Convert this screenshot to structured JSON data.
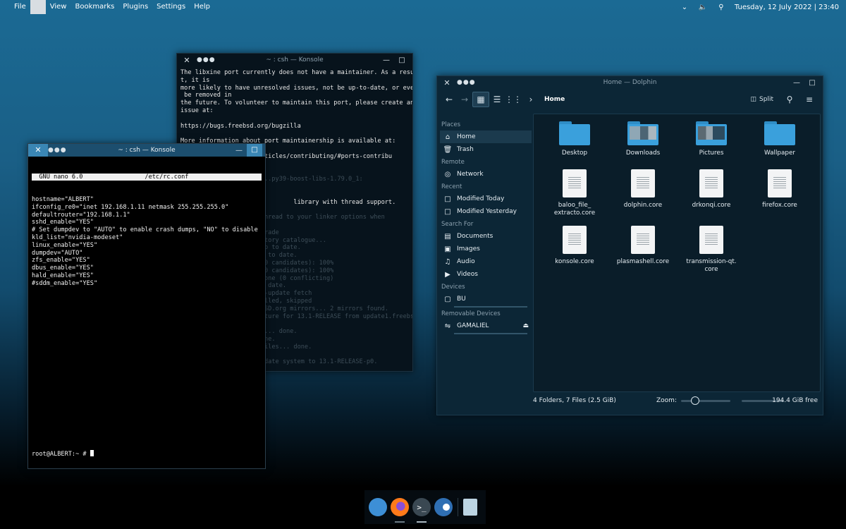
{
  "top_panel": {
    "menu": [
      "File",
      "",
      "View",
      "Bookmarks",
      "Plugins",
      "Settings",
      "Help"
    ],
    "tray_icons": [
      "chevron-down-icon",
      "volume-icon",
      "search-icon"
    ],
    "clock": "Tuesday, 12 July 2022 | 23:40"
  },
  "konsole_back": {
    "title": "~ : csh — Konsole",
    "lines_bright": [
      "The libxine port currently does not have a maintainer. As a resul",
      "t, it is",
      "more likely to have unresolved issues, not be up-to-date, or even",
      " be removed in",
      "the future. To volunteer to maintain this port, please create an",
      "issue at:",
      "",
      "https://bugs.freebsd.org/bugzilla",
      "",
      "More information about port maintainership is available at:"
    ],
    "line_url": "                 /en/articles/contributing/#ports-contribu",
    "line_pkg": "                      ...py39-boost-libs-1.79.0_1:",
    "line_thread": "                               library with thread support.",
    "lines_tail": [
      "Don't forget to add -pthread to your linker options when",
      "linking your code.",
      "root@ALBERT:~ # pkg upgrade",
      "Updating FreeBSD repository catalogue...",
      "FreeBSD repository is up to date.",
      "All repositories are up to date.",
      "Checking for upgrades (0 candidates): 100%",
      "Processing candidates (0 candidates): 100%",
      "Checking integrity... done (0 conflicting)",
      "Your packages are up to date.",
      "root@ALBERT:~ # freebsd-update fetch",
      "src component not installed, skipped",
      "Looking up update.FreeBSD.org mirrors... 2 mirrors found.",
      "Fetching metadata signature for 13.1-RELEASE from update1.freebsd",
      ".org... done.",
      "Fetching metadata index... done.",
      "Inspecting system... done.",
      "Preparing to download files... done.",
      "",
      "No updates needed to update system to 13.1-RELEASE-p0.",
      "root@ALBERT:~ # "
    ]
  },
  "konsole_front": {
    "title": "~ : csh — Konsole",
    "nano_header": "  GNU nano 6.0                 /etc/rc.conf                      ",
    "lines": [
      "hostname=\"ALBERT\"",
      "ifconfig_re0=\"inet 192.168.1.11 netmask 255.255.255.0\"",
      "defaultrouter=\"192.168.1.1\"",
      "sshd_enable=\"YES\"",
      "# Set dumpdev to \"AUTO\" to enable crash dumps, \"NO\" to disable",
      "kld_list=\"nvidia-modeset\"",
      "linux_enable=\"YES\"",
      "dumpdev=\"AUTO\"",
      "zfs_enable=\"YES\"",
      "dbus_enable=\"YES\"",
      "hald_enable=\"YES\"",
      "#sddm_enable=\"YES\""
    ],
    "prompt": "root@ALBERT:~ # "
  },
  "dolphin": {
    "title": "Home — Dolphin",
    "breadcrumb": "Home",
    "split_label": "Split",
    "places": [
      {
        "header": "Places",
        "items": [
          {
            "label": "Home",
            "icon": "home-icon",
            "selected": true
          },
          {
            "label": "Trash",
            "icon": "trash-icon"
          }
        ]
      },
      {
        "header": "Remote",
        "items": [
          {
            "label": "Network",
            "icon": "network-icon"
          }
        ]
      },
      {
        "header": "Recent",
        "items": [
          {
            "label": "Modified Today",
            "icon": "calendar-icon"
          },
          {
            "label": "Modified Yesterday",
            "icon": "calendar-icon"
          }
        ]
      },
      {
        "header": "Search For",
        "items": [
          {
            "label": "Documents",
            "icon": "document-icon"
          },
          {
            "label": "Images",
            "icon": "image-icon"
          },
          {
            "label": "Audio",
            "icon": "music-icon"
          },
          {
            "label": "Videos",
            "icon": "video-icon"
          }
        ]
      },
      {
        "header": "Devices",
        "items": [
          {
            "label": "BU",
            "icon": "drive-icon"
          }
        ]
      },
      {
        "header": "Removable Devices",
        "items": [
          {
            "label": "GAMALIEL",
            "icon": "usb-icon"
          }
        ]
      }
    ],
    "files": [
      {
        "name": "Desktop",
        "kind": "folder"
      },
      {
        "name": "Downloads",
        "kind": "folder"
      },
      {
        "name": "Pictures",
        "kind": "folder"
      },
      {
        "name": "Wallpaper",
        "kind": "folder"
      },
      {
        "name": "baloo_file_\nextracto.core",
        "kind": "file"
      },
      {
        "name": "dolphin.core",
        "kind": "file"
      },
      {
        "name": "drkonqi.core",
        "kind": "file"
      },
      {
        "name": "firefox.core",
        "kind": "file"
      },
      {
        "name": "konsole.core",
        "kind": "file"
      },
      {
        "name": "plasmashell.core",
        "kind": "file"
      },
      {
        "name": "transmission-qt.\ncore",
        "kind": "file"
      }
    ],
    "status": "4 Folders, 7 Files (2.5 GiB)",
    "zoom_label": "Zoom:",
    "free_space": "194.4 GiB free"
  },
  "dock": {
    "items": [
      "kde-icon",
      "firefox-icon",
      "terminal-icon",
      "toggle-icon",
      "trash-icon"
    ]
  }
}
